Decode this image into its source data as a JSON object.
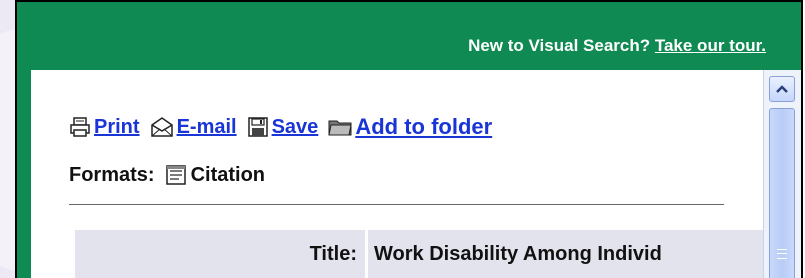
{
  "header": {
    "prompt_text": "New to Visual Search?",
    "tour_link": "Take our tour."
  },
  "toolbar": {
    "print_label": "Print",
    "email_label": "E-mail",
    "save_label": "Save",
    "add_folder_label": "Add to folder",
    "icons": [
      "printer-icon",
      "envelope-icon",
      "floppy-disk-icon",
      "folder-icon"
    ]
  },
  "formats": {
    "label": "Formats:",
    "items": [
      {
        "label": "Citation",
        "icon": "citation-icon"
      }
    ]
  },
  "record": {
    "title_label": "Title:",
    "title_value": "Work Disability Among Individ"
  },
  "colors": {
    "header_green": "#0f8a52",
    "link_blue": "#1a35d6",
    "row_bg": "#e3e3ee",
    "scrollbar_blue": "#b8ccf6"
  }
}
